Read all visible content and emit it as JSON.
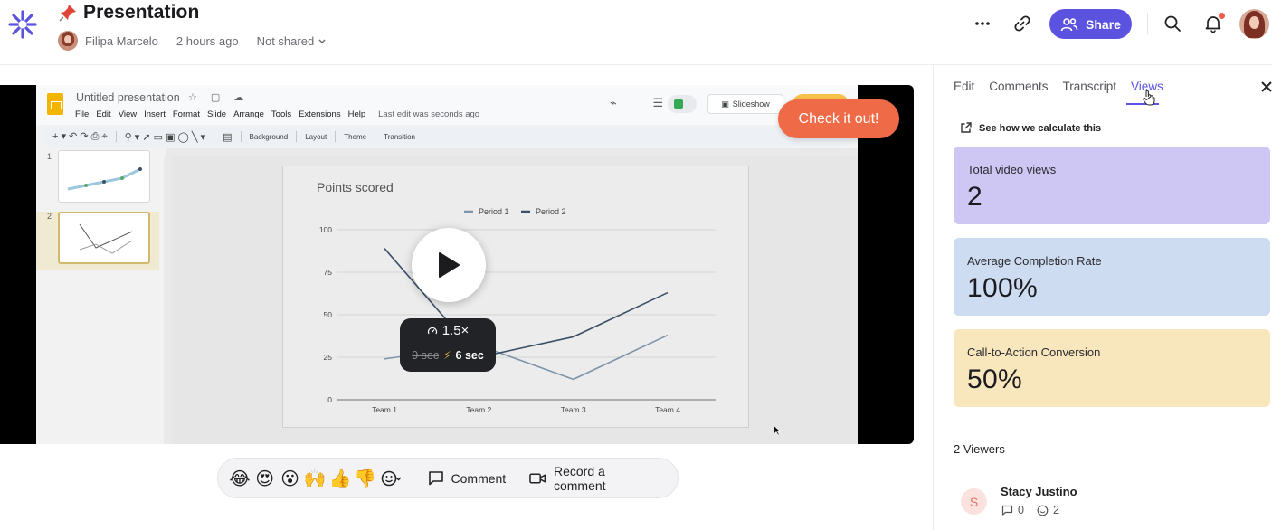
{
  "header": {
    "title": "Presentation",
    "author": "Filipa Marcelo",
    "time": "2 hours ago",
    "share_status": "Not shared",
    "share_button": "Share",
    "icons": [
      "more-icon",
      "link-icon",
      "search-icon",
      "bell-icon"
    ]
  },
  "colors": {
    "accent": "#5b53e0",
    "cta": "#ef6a47",
    "card_views": "#cec6f3",
    "card_completion": "#cddcf0",
    "card_cta": "#f8e6bd"
  },
  "video": {
    "slides_app": {
      "doc_title": "Untitled presentation",
      "menu": [
        "File",
        "Edit",
        "View",
        "Insert",
        "Format",
        "Slide",
        "Arrange",
        "Tools",
        "Extensions",
        "Help"
      ],
      "last_edit": "Last edit was seconds ago",
      "slideshow": "Slideshow",
      "toolbar": [
        "Background",
        "Layout",
        "Theme",
        "Transition"
      ],
      "thumb_numbers": [
        "1",
        "2"
      ]
    },
    "slide_chart": {
      "title": "Points scored",
      "legend": [
        "Period 1",
        "Period 2"
      ]
    },
    "speed": {
      "multiplier": "1.5×",
      "original": "9 sec",
      "fast": "6 sec"
    },
    "cta_label": "Check it out!"
  },
  "chart_data": {
    "type": "line",
    "title": "Points scored",
    "categories": [
      "Team 1",
      "Team 2",
      "Team 3",
      "Team 4"
    ],
    "series": [
      {
        "name": "Period 1",
        "values": [
          24,
          32,
          12,
          38
        ],
        "color": "#7d95aa"
      },
      {
        "name": "Period 2",
        "values": [
          89,
          25,
          37,
          63
        ],
        "color": "#3c5068"
      }
    ],
    "ylim": [
      0,
      100
    ],
    "yticks": [
      "0",
      "25",
      "50",
      "75",
      "100"
    ],
    "grid": true,
    "legend_position": "top"
  },
  "reactions": {
    "emojis": [
      "😂",
      "😍",
      "😮",
      "🙌",
      "👍",
      "👎"
    ],
    "comment": "Comment",
    "record": "Record a comment"
  },
  "panel": {
    "tabs": [
      "Edit",
      "Comments",
      "Transcript",
      "Views"
    ],
    "active_tab": "Views",
    "calc_link": "See how we calculate this",
    "stats": {
      "views_label": "Total video views",
      "views_value": "2",
      "completion_label": "Average Completion Rate",
      "completion_value": "100%",
      "cta_label": "Call-to-Action Conversion",
      "cta_value": "50%"
    },
    "viewers_count": "2 Viewers",
    "viewer": {
      "initial": "S",
      "name": "Stacy Justino",
      "comments": "0",
      "reactions": "2"
    }
  }
}
